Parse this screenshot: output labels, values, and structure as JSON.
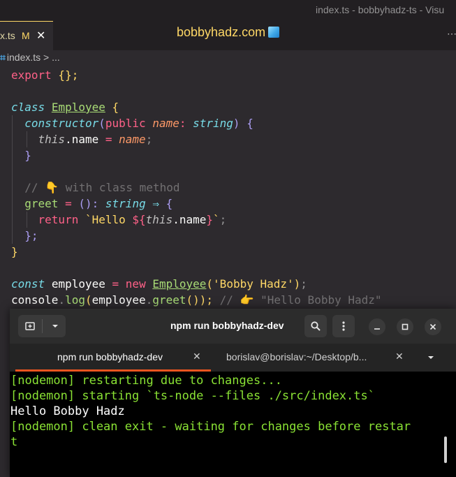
{
  "window": {
    "title": "index.ts - bobbyhadz-ts - Visu"
  },
  "editor_tab": {
    "name": "x.ts",
    "modified_flag": "M",
    "close_glyph": "✕"
  },
  "watermark": "bobbyhadz.com",
  "breadcrumb": {
    "file": "index.ts",
    "sep": ">",
    "more": "..."
  },
  "code": {
    "l1": {
      "kw": "export",
      "rest": " {};"
    },
    "l3": {
      "kw": "class",
      "name": "Employee",
      "brace": "{"
    },
    "l4": {
      "kw": "constructor",
      "p1": "(",
      "mod": "public",
      "param": "name",
      "colon": ":",
      "type": "string",
      "p2": ")",
      "brace": "{"
    },
    "l5": {
      "this": "this",
      "rest": ".name",
      "eq": "=",
      "param": "name",
      "semi": ";"
    },
    "l6": {
      "brace": "}"
    },
    "l8": {
      "text": "// 👇 with class method"
    },
    "l9": {
      "name": "greet",
      "eq": "=",
      "parens": "():",
      "type": "string",
      "arrow": "⇒",
      "brace": "{"
    },
    "l10": {
      "kw": "return",
      "s1": "`Hello ",
      "i1": "${",
      "this": "this",
      "mem": ".name",
      "i2": "}",
      "s2": "`",
      "semi": ";"
    },
    "l11": {
      "brace": "};"
    },
    "l12": {
      "brace": "}"
    },
    "l14": {
      "kw": "const",
      "var": "employee",
      "eq": "=",
      "new": "new",
      "cls": "Employee",
      "p1": "(",
      "arg": "'Bobby Hadz'",
      "p2": ")",
      "semi": ";"
    },
    "l15": {
      "obj": "console",
      "dot1": ".",
      "fn": "log",
      "p1": "(",
      "var": "employee",
      "dot2": ".",
      "call": "greet",
      "p2": "());",
      "cmt": "// 👉 \"Hello Bobby Hadz\""
    }
  },
  "terminal": {
    "title": "npm run bobbyhadz-dev",
    "tabs": [
      {
        "label": "npm run bobbyhadz-dev",
        "close": "✕"
      },
      {
        "label": "borislav@borislav:~/Desktop/b...",
        "close": "✕"
      }
    ],
    "lines": [
      "[nodemon] restarting due to changes...",
      "[nodemon] starting `ts-node --files ./src/index.ts`",
      "Hello Bobby Hadz",
      "[nodemon] clean exit - waiting for changes before restar",
      "t"
    ]
  },
  "icons": {
    "new_tab": "new-tab-icon",
    "dropdown": "chevron-down-icon",
    "search": "search-icon",
    "menu": "kebab-menu-icon",
    "minimize": "minimize-icon",
    "maximize": "maximize-icon",
    "close": "close-icon"
  },
  "colors": {
    "editor_bg": "#2d2a2e",
    "keyword": "#ff6188",
    "function": "#a9dc76",
    "type": "#78dce8",
    "string": "#ffd866",
    "terminal_green": "#8ae234",
    "tab_indicator": "#e95420"
  }
}
